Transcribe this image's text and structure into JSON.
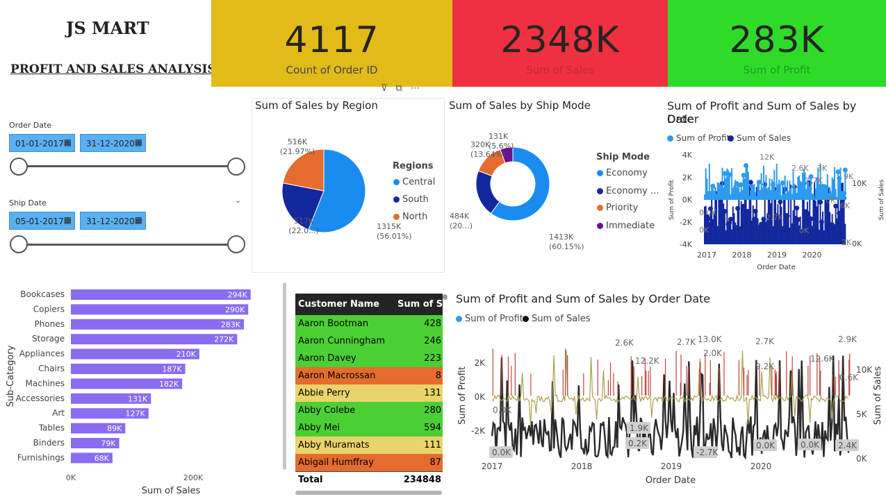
{
  "header": {
    "title": "JS MART",
    "subtitle": "PROFIT AND SALES ANALYSIS"
  },
  "kpis": [
    {
      "value": "4117",
      "label": "Count of Order ID",
      "bg": "#e2bb18",
      "label_color": "#444444"
    },
    {
      "value": "2348K",
      "label": "Sum of Sales",
      "bg": "#ee3040",
      "label_color": "#c4283a"
    },
    {
      "value": "283K",
      "label": "Sum of Profit",
      "bg": "#2edb29",
      "label_color": "#1e9a1c"
    }
  ],
  "filters": {
    "order_date": {
      "label": "Order Date",
      "start": "01-01-2017",
      "end": "31-12-2020"
    },
    "ship_date": {
      "label": "Ship Date",
      "start": "05-01-2017",
      "end": "31-12-2020"
    }
  },
  "region_pie": {
    "title": "Sum of Sales by Region",
    "legend_title": "Regions",
    "labels": [
      {
        "line1": "516K",
        "line2": "(21.97%)"
      },
      {
        "line1": "517K",
        "line2": "(22.0...)"
      },
      {
        "line1": "1315K",
        "line2": "(56.01%)"
      }
    ]
  },
  "ship_donut": {
    "title": "Sum of Sales by Ship Mode",
    "legend_title": "Ship Mode",
    "labels": [
      {
        "line1": "131K",
        "line2": "(5.6%)"
      },
      {
        "line1": "320K",
        "line2": "(13.64%)"
      },
      {
        "line1": "484K",
        "line2": "(20...)"
      },
      {
        "line1": "1413K",
        "line2": "(60.15%)"
      }
    ]
  },
  "small_line": {
    "title_l1": "Sum of Profit and Sum of Sales by Order",
    "title_l2": "Date",
    "legend": [
      "Sum of Profit",
      "Sum of Sales"
    ],
    "y_left_ticks": [
      "4K",
      "2K",
      "0K",
      "-2K",
      "-4K"
    ],
    "y_right_ticks": [
      "10K",
      "0K"
    ],
    "x_ticks": [
      "2017",
      "2018",
      "2019",
      "2020"
    ],
    "y_left_label": "Sum of Profit",
    "y_right_label": "Sum of Sales",
    "x_label": "Order Date",
    "annotations": [
      "12K",
      "2.6K",
      "3K",
      "2.7K",
      "0.0K",
      "0K",
      "2.7K",
      "9K",
      "0K",
      "6K",
      "0K",
      "0K",
      "2K"
    ]
  },
  "bar_chart": {
    "ylabel": "Sub-Category",
    "xlabel": "Sum of Sales",
    "x_ticks": [
      "0K",
      "200K"
    ],
    "bar_color": "#8a6cf0"
  },
  "table": {
    "header_name": "Customer Name",
    "header_sales": "Sum of Sales",
    "total_label": "Total",
    "total_value": "234848",
    "rows": [
      {
        "name": "Aaron Bootman",
        "sales": "428",
        "color": "#4ccf34"
      },
      {
        "name": "Aaron Cunningham",
        "sales": "246",
        "color": "#4ccf34"
      },
      {
        "name": "Aaron Davey",
        "sales": "223",
        "color": "#4ccf34"
      },
      {
        "name": "Aaron Macrossan",
        "sales": "8",
        "color": "#e56c2e"
      },
      {
        "name": "Abbie Perry",
        "sales": "131",
        "color": "#e8d46a"
      },
      {
        "name": "Abby Colebe",
        "sales": "280",
        "color": "#4ccf34"
      },
      {
        "name": "Abby Mei",
        "sales": "594",
        "color": "#4ccf34"
      },
      {
        "name": "Abby Muramats",
        "sales": "111",
        "color": "#e8d46a"
      },
      {
        "name": "Abigail Humffray",
        "sales": "87",
        "color": "#e56c2e"
      }
    ]
  },
  "big_line": {
    "title": "Sum of Profit and Sum of Sales by Order Date",
    "legend": [
      "Sum of Profit",
      "Sum of Sales"
    ],
    "y_left_ticks": [
      "2K",
      "0K",
      "-2K"
    ],
    "y_right_ticks": [
      "10K",
      "5K",
      "0K"
    ],
    "x_ticks": [
      "2017",
      "2018",
      "2019",
      "2020"
    ],
    "y_left_label": "Sum of Profit",
    "y_right_label": "Sum of Sales",
    "x_label": "Order Date",
    "top_annotations": [
      "2.6K",
      "12.2K",
      "2.7K",
      "13.0K",
      "2.0K",
      "2.7K",
      "9.2K",
      "12.6K",
      "2.9K",
      "0.6K",
      "0.0K"
    ],
    "box_annotations": [
      "1.9K",
      "0.2K",
      "0.0K",
      "-2.7K",
      "0.0K",
      "0.0K",
      "2.4K"
    ]
  },
  "chart_data": [
    {
      "type": "bar",
      "title": "",
      "categories": [
        "Bookcases",
        "Copiers",
        "Phones",
        "Storage",
        "Appliances",
        "Chairs",
        "Machines",
        "Accessories",
        "Art",
        "Tables",
        "Binders",
        "Furnishings"
      ],
      "values": [
        294,
        290,
        283,
        272,
        210,
        187,
        182,
        131,
        127,
        89,
        79,
        68
      ],
      "value_labels": [
        "294K",
        "290K",
        "283K",
        "272K",
        "210K",
        "187K",
        "182K",
        "131K",
        "127K",
        "89K",
        "79K",
        "68K"
      ],
      "xlabel": "Sum of Sales",
      "ylabel": "Sub-Category",
      "xlim": [
        0,
        300
      ]
    },
    {
      "type": "pie",
      "title": "Sum of Sales by Region",
      "categories": [
        "Central",
        "South",
        "North"
      ],
      "values": [
        1315,
        517,
        516
      ],
      "colors": [
        "#1a8cf0",
        "#13289c",
        "#e56c2e"
      ]
    },
    {
      "type": "pie",
      "title": "Sum of Sales by Ship Mode",
      "categories": [
        "Economy",
        "Economy ...",
        "Priority",
        "Immediate"
      ],
      "values": [
        1413,
        484,
        320,
        131
      ],
      "colors": [
        "#1a8cf0",
        "#13289c",
        "#e56c2e",
        "#6a118d"
      ]
    }
  ]
}
